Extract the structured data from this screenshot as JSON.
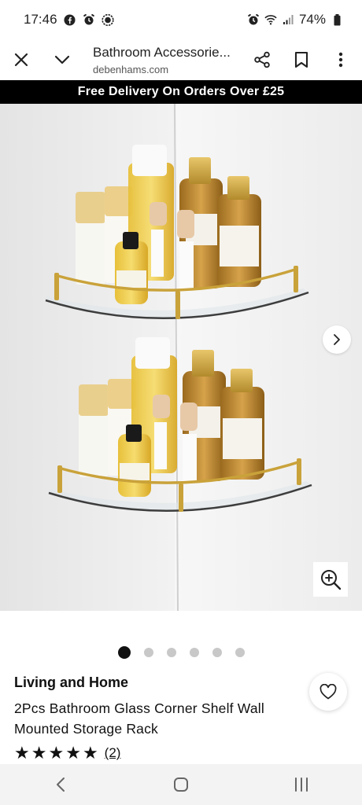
{
  "status_bar": {
    "time": "17:46",
    "battery": "74%",
    "icons_left": [
      "facebook-icon",
      "alarm-icon",
      "signal-app-icon"
    ],
    "icons_right": [
      "alarm-icon",
      "wifi-icon",
      "cell-signal-icon",
      "battery-icon"
    ]
  },
  "toolbar": {
    "title": "Bathroom Accessorie...",
    "url": "debenhams.com",
    "icons": [
      "close-icon",
      "chevron-down-icon",
      "share-icon",
      "bookmark-icon",
      "more-vert-icon"
    ]
  },
  "promo": {
    "text": "Free Delivery On Orders Over £25"
  },
  "gallery": {
    "image_count": 6,
    "active_index": 0,
    "icons": [
      "chevron-right-icon",
      "zoom-in-icon"
    ]
  },
  "product": {
    "brand": "Living and Home",
    "title": "2Pcs Bathroom Glass Corner Shelf Wall Mounted Storage Rack",
    "rating_stars": 5,
    "stars": [
      "★",
      "★",
      "★",
      "★",
      "★"
    ],
    "review_count": "(2)"
  },
  "nav": {
    "icons": [
      "back-icon",
      "home-icon",
      "recents-icon"
    ]
  },
  "colors": {
    "banner": "#000000",
    "gold": "#c9a23a",
    "amber": "#b8822a"
  }
}
